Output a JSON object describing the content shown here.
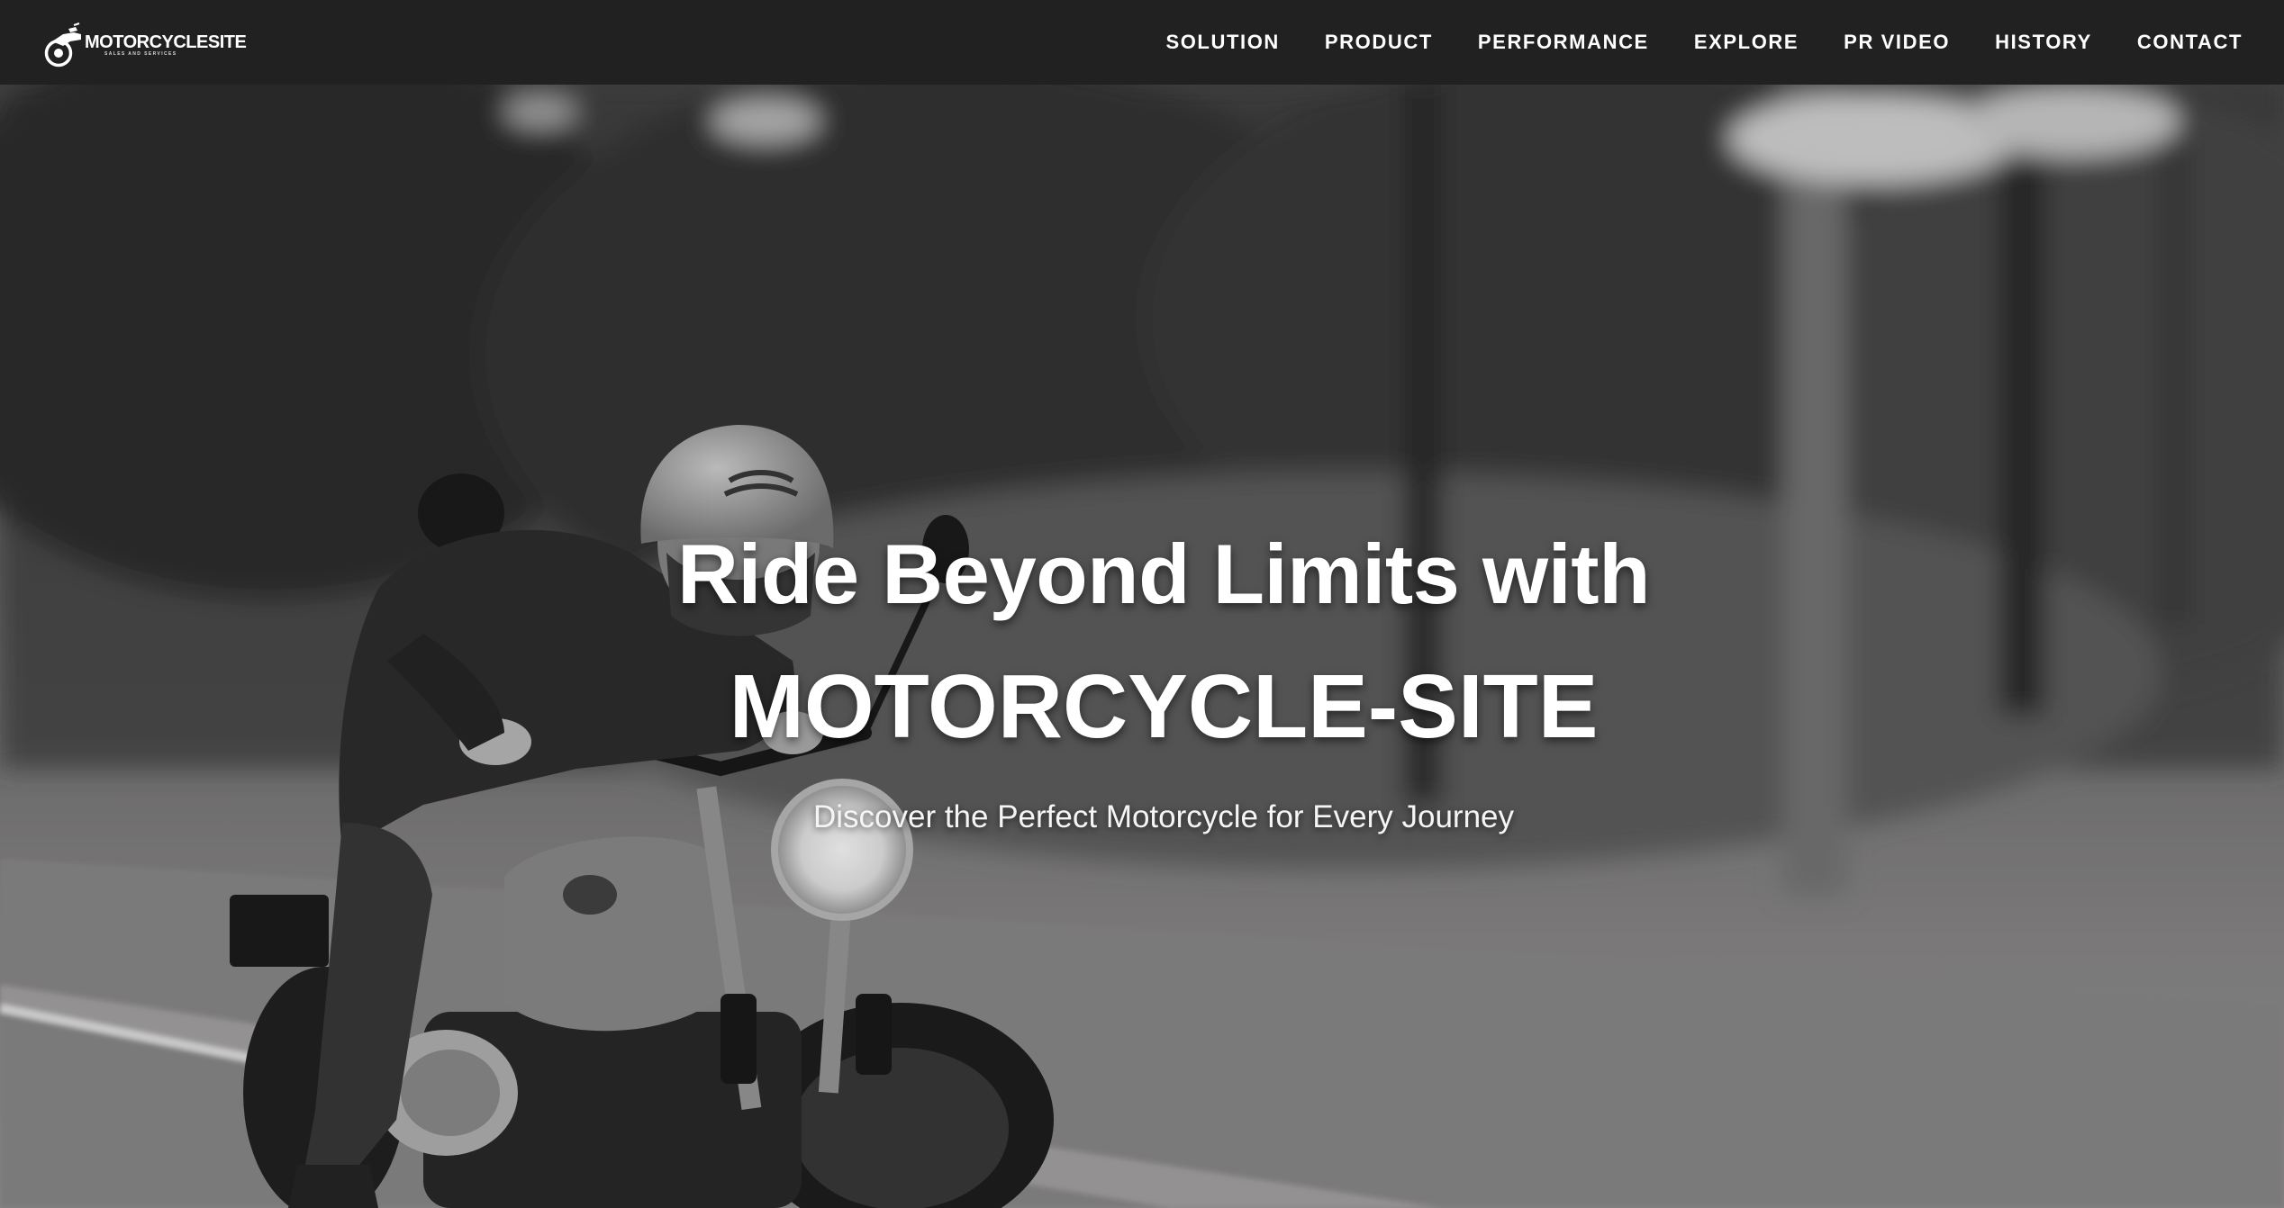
{
  "header": {
    "logo": {
      "name": "MOTORCYCLESITE",
      "tagline": "SALES AND SERVICES",
      "icon": "motorcycle-logo-icon"
    },
    "nav": [
      {
        "label": "SOLUTION"
      },
      {
        "label": "PRODUCT"
      },
      {
        "label": "PERFORMANCE"
      },
      {
        "label": "EXPLORE"
      },
      {
        "label": "PR VIDEO"
      },
      {
        "label": "HISTORY"
      },
      {
        "label": "CONTACT"
      }
    ]
  },
  "hero": {
    "title_line1": "Ride Beyond Limits with",
    "title_line2": "MOTORCYCLE-SITE",
    "subtitle": "Discover the Perfect Motorcycle for Every Journey",
    "background": "grayscale-photo-rider-on-motorcycle-forest-road"
  },
  "colors": {
    "header_bg": "#212121",
    "text": "#ffffff"
  }
}
